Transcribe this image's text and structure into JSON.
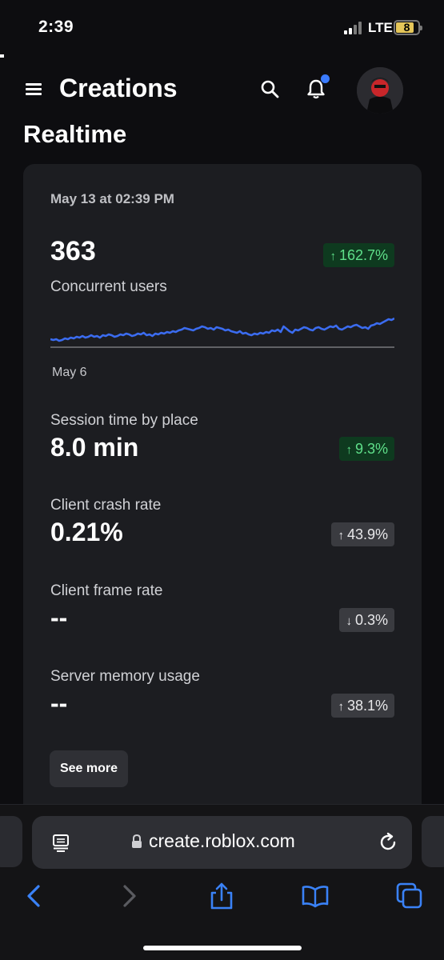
{
  "status_bar": {
    "time": "2:39",
    "network": "LTE",
    "battery": "8"
  },
  "header": {
    "title": "Creations"
  },
  "section": {
    "title": "Realtime"
  },
  "card": {
    "date": "May 13 at 02:39 PM",
    "concurrent": {
      "value": "363",
      "label": "Concurrent users",
      "change": "162.7%",
      "direction": "up",
      "color": "#5fe08a"
    },
    "chart": {
      "axis_label": "May 6",
      "line_color": "#3b6cf0",
      "series": [
        10,
        9,
        10,
        8,
        9,
        11,
        10,
        12,
        11,
        13,
        12,
        14,
        12,
        13,
        15,
        13,
        14,
        12,
        15,
        14,
        16,
        15,
        13,
        14,
        16,
        15,
        17,
        16,
        14,
        15,
        17,
        16,
        18,
        15,
        16,
        14,
        17,
        16,
        18,
        17,
        19,
        18,
        20,
        19,
        21,
        22,
        24,
        23,
        22,
        21,
        23,
        24,
        26,
        25,
        23,
        24,
        22,
        25,
        24,
        23,
        21,
        22,
        20,
        19,
        18,
        20,
        17,
        18,
        16,
        15,
        17,
        16,
        18,
        17,
        19,
        18,
        21,
        20,
        22,
        19,
        26,
        23,
        20,
        18,
        22,
        21,
        23,
        25,
        24,
        22,
        21,
        24,
        25,
        23,
        22,
        24,
        26,
        25,
        27,
        23,
        22,
        24,
        26,
        25,
        27,
        28,
        26,
        24,
        25,
        23,
        27,
        28,
        30,
        29,
        31,
        33,
        35,
        34,
        36
      ]
    },
    "metrics": [
      {
        "label": "Session time by place",
        "value": "8.0 min",
        "change": "9.3%",
        "direction": "up",
        "tone": "green"
      },
      {
        "label": "Client crash rate",
        "value": "0.21%",
        "change": "43.9%",
        "direction": "up",
        "tone": "gray"
      },
      {
        "label": "Client frame rate",
        "value": "--",
        "change": "0.3%",
        "direction": "down",
        "tone": "gray"
      },
      {
        "label": "Server memory usage",
        "value": "--",
        "change": "38.1%",
        "direction": "up",
        "tone": "gray"
      }
    ],
    "see_more_label": "See more"
  },
  "browser": {
    "url": "create.roblox.com",
    "accent": "#3a82f7"
  },
  "arrows": {
    "up": "↑",
    "down": "↓"
  }
}
